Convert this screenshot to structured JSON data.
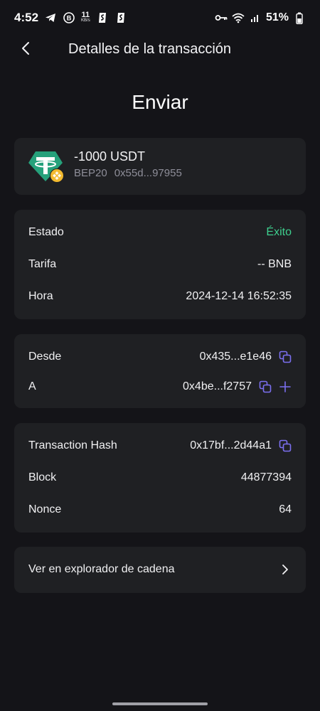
{
  "status_bar": {
    "time": "4:52",
    "net_speed_value": "11",
    "net_speed_unit": "KB/s",
    "battery": "51%",
    "icons": [
      "telegram-icon",
      "b-circle-icon",
      "app-s-icon",
      "app-s-icon",
      "key-icon",
      "wifi-icon",
      "signal-icon",
      "battery-icon"
    ]
  },
  "header": {
    "title": "Detalles de la transacción",
    "back_icon": "chevron-left-icon"
  },
  "page_title": "Enviar",
  "token": {
    "amount": "-1000 USDT",
    "network": "BEP20",
    "address": "0x55d...97955",
    "logo": "tether-icon",
    "badge": "bnb-icon",
    "colors": {
      "tether": "#26a17b",
      "bnb": "#f3ba2f"
    }
  },
  "info": {
    "status_label": "Estado",
    "status_value": "Éxito",
    "fee_label": "Tarifa",
    "fee_value": "-- BNB",
    "time_label": "Hora",
    "time_value": "2024-12-14 16:52:35"
  },
  "addresses": {
    "from_label": "Desde",
    "from_value": "0x435...e1e46",
    "to_label": "A",
    "to_value": "0x4be...f2757"
  },
  "chain": {
    "hash_label": "Transaction Hash",
    "hash_value": "0x17bf...2d44a1",
    "block_label": "Block",
    "block_value": "44877394",
    "nonce_label": "Nonce",
    "nonce_value": "64"
  },
  "explorer": {
    "label": "Ver en explorador de cadena"
  },
  "colors": {
    "background": "#141418",
    "card": "#1f2023",
    "success": "#3ecf8e",
    "accent": "#7b6ff0",
    "muted": "#8e8e99"
  }
}
